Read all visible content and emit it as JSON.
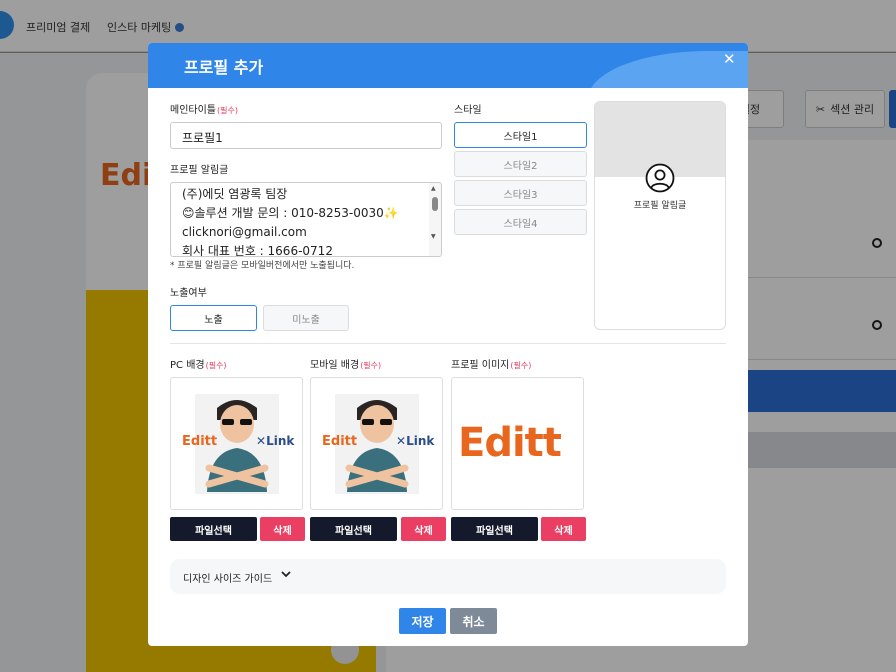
{
  "background": {
    "nav": [
      "프리미엄 결제",
      "인스타 마케팅"
    ],
    "logo": {
      "accent": "E",
      "rest": "di"
    },
    "buttons": [
      "설정",
      "섹션 관리"
    ]
  },
  "modal": {
    "title": "프로필 추가",
    "main_title": {
      "label": "메인타이틀",
      "required": "(필수)",
      "value": "프로필1"
    },
    "notice": {
      "label": "프로필 알림글",
      "lines": [
        "(주)에딧 염광록 팀장",
        "😊솔루션 개발 문의 : 010-8253-0030✨",
        "clicknori@gmail.com",
        "회사 대표 번호 : 1666-0712"
      ],
      "hint": "* 프로필 알림글은 모바일버전에서만 노출됩니다."
    },
    "style": {
      "label": "스타일",
      "options": [
        "스타일1",
        "스타일2",
        "스타일3",
        "스타일4"
      ],
      "selected": "스타일1"
    },
    "preview_text": "프로필 알림글",
    "exposure": {
      "label": "노출여부",
      "options": [
        "노출",
        "미노출"
      ],
      "selected": "노출"
    },
    "images": [
      {
        "label": "PC 배경",
        "required": "(필수)",
        "brand": "Editt",
        "brand_accent": "E",
        "brand_rest": "ditt",
        "partner": "Link",
        "select": "파일선택",
        "delete": "삭제"
      },
      {
        "label": "모바일 배경",
        "required": "(필수)",
        "brand": "Editt",
        "brand_accent": "E",
        "brand_rest": "ditt",
        "partner": "Link",
        "select": "파일선택",
        "delete": "삭제"
      },
      {
        "label": "프로필 이미지",
        "required": "(필수)",
        "brand": "Editt",
        "brand_accent": "E",
        "brand_rest": "ditt",
        "select": "파일선택",
        "delete": "삭제"
      }
    ],
    "guide": "디자인 사이즈 가이드",
    "save": "저장",
    "cancel": "취소"
  },
  "colors": {
    "primary": "#2f86e8",
    "danger": "#eb3e63",
    "dark": "#141a2b",
    "muted": "#7f8a99",
    "brand_orange": "#e8661e"
  }
}
